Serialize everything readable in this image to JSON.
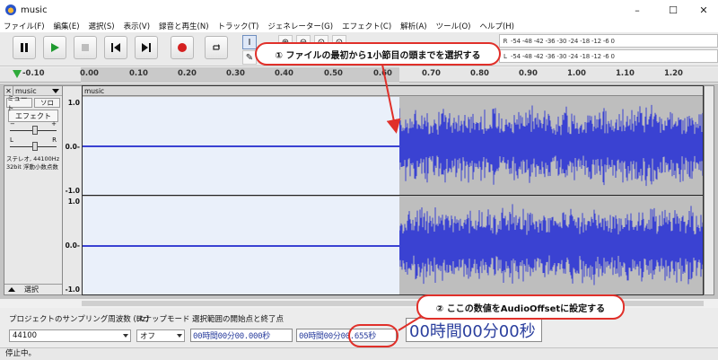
{
  "window": {
    "title": "music",
    "controls": [
      "–",
      "☐",
      "✕"
    ]
  },
  "menu": [
    "ファイル(F)",
    "編集(E)",
    "選択(S)",
    "表示(V)",
    "録音と再生(N)",
    "トラック(T)",
    "ジェネレーター(G)",
    "エフェクト(C)",
    "解析(A)",
    "ツール(O)",
    "ヘルプ(H)"
  ],
  "transport": {
    "buttons": [
      {
        "name": "pause-button",
        "icon": "pause-icon"
      },
      {
        "name": "play-button",
        "icon": "play-icon"
      },
      {
        "name": "stop-button",
        "icon": "stop-icon"
      },
      {
        "name": "skip-start-button",
        "icon": "skip-start-icon"
      },
      {
        "name": "skip-end-button",
        "icon": "skip-end-icon"
      },
      {
        "name": "record-button",
        "icon": "record-icon"
      },
      {
        "name": "loop-button",
        "icon": "loop-icon"
      }
    ]
  },
  "meters": {
    "scale": "-54 -48 -42 -36 -30 -24 -18 -12  -6  0",
    "record_label": "R",
    "play_label": "L"
  },
  "ruler": {
    "ticks": [
      "-0.10",
      "0.00",
      "0.10",
      "0.20",
      "0.30",
      "0.40",
      "0.50",
      "0.60",
      "0.70",
      "0.80",
      "0.90",
      "1.00",
      "1.10",
      "1.20"
    ]
  },
  "track": {
    "name": "music",
    "mute": "ミュート",
    "solo": "ソロ",
    "effect": "エフェクト",
    "gain_minus": "−",
    "gain_plus": "+",
    "pan_left": "L",
    "pan_right": "R",
    "info_line1": "ステレオ, 44100Hz",
    "info_line2": "32bit 浮動小数点数",
    "select": "選択",
    "clip_name": "music",
    "scale_top": [
      "1.0",
      "0.0-",
      "-1.0"
    ],
    "scale_bottom": [
      "1.0",
      "0.0-",
      "-1.0"
    ]
  },
  "bottom": {
    "rate_label": "プロジェクトのサンプリング周波数 (Hz)",
    "snap_label": "スナップモード",
    "selection_label": "選択範囲の開始点と終了点",
    "rate_value": "44100",
    "snap_value": "オフ",
    "start_time": "00時間00分00.000秒",
    "end_time": "00時間00分00.655秒",
    "big_time": "00時間00分00秒"
  },
  "status": "停止中。",
  "annotations": {
    "callout1": "① ファイルの最初から1小節目の頭までを選択する",
    "callout2": "② ここの数値をAudioOffsetに設定する"
  },
  "colors": {
    "waveform": "#3a42d2",
    "accent_red": "#e0302a",
    "time_text": "#2b3f9e"
  }
}
